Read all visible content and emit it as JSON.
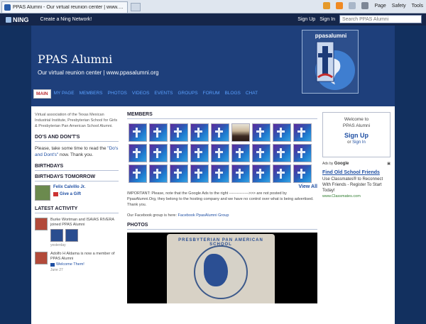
{
  "browser": {
    "tab_title": "PPAS Alumni - Our virtual reunion center | www.ppas...",
    "commands": [
      "Page",
      "Safety",
      "Tools"
    ]
  },
  "ning_bar": {
    "logo": "NING",
    "create_link": "Create a Ning Network!",
    "sign_up": "Sign Up",
    "sign_in": "Sign In",
    "search_placeholder": "Search PPAS Alumni"
  },
  "header": {
    "title": "PPAS Alumni",
    "subtitle": "Our virtual reunion center | www.ppasalumni.org",
    "logo_text": "ppasalumni"
  },
  "nav": {
    "items": [
      "Main",
      "My Page",
      "Members",
      "Photos",
      "Videos",
      "Events",
      "Groups",
      "Forum",
      "Blogs",
      "Chat"
    ],
    "active_index": 0
  },
  "left": {
    "description": "Virtual association of the Texas Mexican Industrial Institute, Presbyterian School for Girls & Presbyterian Pan American School Alumni.",
    "dos_heading": "DO'S AND DON'T'S",
    "dos_text_before": "Please, take some time to read the",
    "dos_link": "\"Do's and Dont's\"",
    "dos_text_after": "now. Thank you.",
    "birthdays_heading": "BIRTHDAYS",
    "birthdays_tomorrow_heading": "BIRTHDAYS TOMORROW",
    "birthday_name": "Felix Calvillo Jr.",
    "give_gift": "Give a Gift",
    "latest_heading": "LATEST ACTIVITY",
    "activity1": "Burke Wortman and ISAIAS RIVERA joined PPAS Alumni",
    "activity1_date": "yesterday",
    "activity2": "Adolfo H Aldama is now a member of PPAS Alumni",
    "activity2_link": "Welcome Them!",
    "activity2_date": "June 27"
  },
  "center": {
    "members_heading": "MEMBERS",
    "view_all": "View All",
    "notice": "IMPORTANT: Please, note that the Google Ads to the right --------------->>> are not posted by PpasAlumni.Org, they belong to the hosting company and we have no control over what is being advertised. Thank you.",
    "fb_before": "Our Facebook group is here:",
    "fb_link": "Facebook PpasAlumni Group",
    "photos_heading": "PHOTOS",
    "photo_caption": "PRESBYTERIAN PAN AMERICAN SCHOOL"
  },
  "right": {
    "welcome_line1": "Welcome to",
    "welcome_line2": "PPAS Alumni",
    "sign_up": "Sign Up",
    "or": "or",
    "sign_in": "Sign In",
    "ads_label": "Ads by",
    "ads_brand": "Google",
    "ad_title": "Find Old School Friends",
    "ad_body": "Use Classmates® to Reconnect With Friends - Register To Start Today!",
    "ad_url": "www.Classmates.com"
  }
}
